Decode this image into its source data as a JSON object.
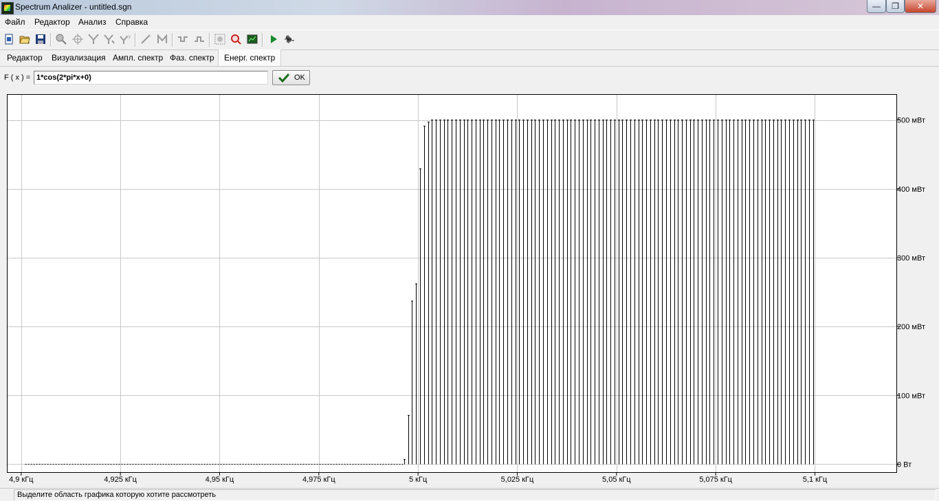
{
  "window": {
    "title": "Spectrum Analizer - untitled.sgn",
    "btn_minimize": "—",
    "btn_maximize": "❐",
    "btn_close": "✕"
  },
  "menu": [
    "Файл",
    "Редактор",
    "Анализ",
    "Справка"
  ],
  "toolbar": {
    "icons": [
      "new-doc-icon",
      "open-folder-icon",
      "save-icon",
      "zoom-icon",
      "crosshair-icon",
      "filter-icon",
      "filter-alt-icon",
      "filter-xy-icon",
      "line-icon",
      "bracket-icon",
      "wave-step-icon",
      "wave-step-alt-icon",
      "zoom-region-icon",
      "zoom-reset-icon",
      "chart-view-icon",
      "play-icon",
      "signal-icon"
    ]
  },
  "tabs": [
    "Редактор",
    "Визуализация",
    "Ампл. спектр",
    "Фаз. спектр",
    "Енерг. спектр"
  ],
  "active_tab": "Енерг. спектр",
  "formula": {
    "label": "F ( x ) =",
    "value": "1*cos(2*pi*x+0)",
    "ok_label": "OK"
  },
  "status": {
    "text": "Выделите область графика которую хотите рассмотреть"
  },
  "chart_data": {
    "type": "stem",
    "xlabel": "",
    "ylabel": "",
    "xlim": [
      4.8964,
      5.1207
    ],
    "ylim": [
      -0.0125,
      0.5375
    ],
    "x_ticks": [
      4.9,
      4.925,
      4.95,
      4.975,
      5.0,
      5.025,
      5.05,
      5.075,
      5.1
    ],
    "x_tick_labels": [
      "4,9 кГц",
      "4,925 кГц",
      "4,95 кГц",
      "4,975 кГц",
      "5 кГц",
      "5,025 кГц",
      "5,05 кГц",
      "5,075 кГц",
      "5,1 кГц"
    ],
    "y_ticks": [
      0,
      0.1,
      0.2,
      0.3,
      0.4,
      0.5
    ],
    "y_tick_labels": [
      "0 Вт",
      "100 мВт",
      "200 мВт",
      "300 мВт",
      "400 мВт",
      "500 мВт"
    ],
    "grid": true,
    "near_zero_start": 4.901,
    "near_zero_end": 4.9965,
    "stems": [
      {
        "x": 4.9965,
        "y": 0.007
      },
      {
        "x": 4.9975,
        "y": 0.071
      },
      {
        "x": 4.9985,
        "y": 0.237
      },
      {
        "x": 4.9995,
        "y": 0.262
      },
      {
        "x": 5.0005,
        "y": 0.429
      },
      {
        "x": 5.0015,
        "y": 0.491
      },
      {
        "x": 5.0025,
        "y": 0.497
      }
    ],
    "flat_stems": {
      "start": 5.0035,
      "end": 5.1,
      "step": 0.001,
      "y": 0.5
    }
  }
}
